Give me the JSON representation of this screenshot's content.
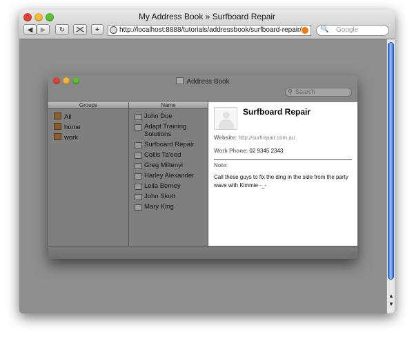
{
  "browser": {
    "title": "My Address Book » Surfboard Repair",
    "url": "http://localhost:8888/tutorials/addressbook/surfboard-repair/",
    "search_placeholder": "Google",
    "back_glyph": "◀",
    "forward_glyph": "▶",
    "reload_glyph": "↻",
    "add_glyph": "+",
    "scroll_up_glyph": "▲",
    "scroll_down_glyph": "▼"
  },
  "address_book": {
    "title": "Address Book",
    "search_placeholder": "Search",
    "groups_header": "Groups",
    "name_header": "Name",
    "groups": [
      "All",
      "home",
      "work"
    ],
    "names": [
      "John Doe",
      "Adapt Training Solutions",
      "Surfboard Repair",
      "Collis Ta'eed",
      "Greg Miltenyi",
      "Harley Alexander",
      "Leila Berney",
      "John Skott",
      "Mary King"
    ]
  },
  "contact": {
    "name": "Surfboard Repair",
    "website_label": "Website:",
    "website_value": "http://surfrepair.com.au",
    "phone_label": "Work Phone:",
    "phone_value": "02 9345 2343",
    "note_label": "Note:",
    "note_text": "Call these guys to fix the ding in the side from the party wave with Kimmie -_-"
  },
  "colors": {
    "traffic_close": "#e0443a",
    "traffic_min": "#f2b93b",
    "traffic_max": "#5cbf38",
    "scroll_thumb": "#3d7fe8"
  }
}
